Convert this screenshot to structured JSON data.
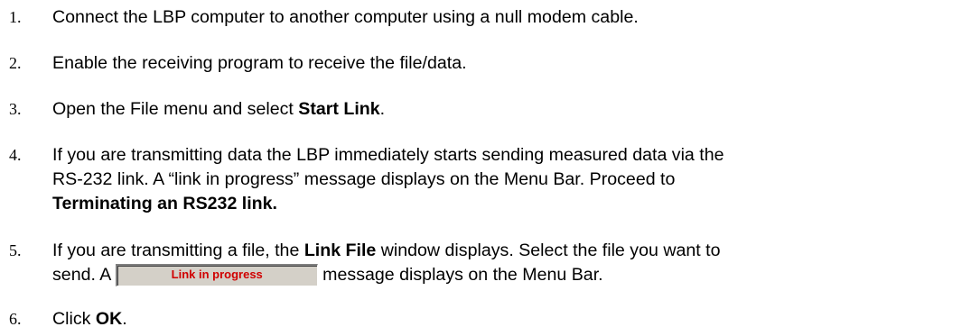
{
  "steps": [
    {
      "number": "1.",
      "text": "Connect the LBP computer to another computer using a null modem cable."
    },
    {
      "number": "2.",
      "text": "Enable the receiving program to receive the file/data."
    },
    {
      "number": "3.",
      "pre": "Open the File menu and select ",
      "bold": "Start Link",
      "post": "."
    },
    {
      "number": "4.",
      "line1": "If you are transmitting data the LBP immediately starts sending measured data via the",
      "line2": "RS-232 link. A “link in progress” message displays on the Menu Bar. Proceed to",
      "line3_bold": "Terminating an RS232 link."
    },
    {
      "number": "5.",
      "line1_pre": "If you are transmitting a file, the ",
      "line1_bold": "Link File",
      "line1_post": " window displays. Select the file you want to",
      "line2_pre": "send. A ",
      "status_label": "Link in progress",
      "line2_post": " message displays on the Menu Bar."
    },
    {
      "number": "6.",
      "pre": "Click ",
      "bold": "OK",
      "post": "."
    }
  ],
  "colors": {
    "status_text": "#d00000",
    "status_background": "#d4d0c8"
  }
}
